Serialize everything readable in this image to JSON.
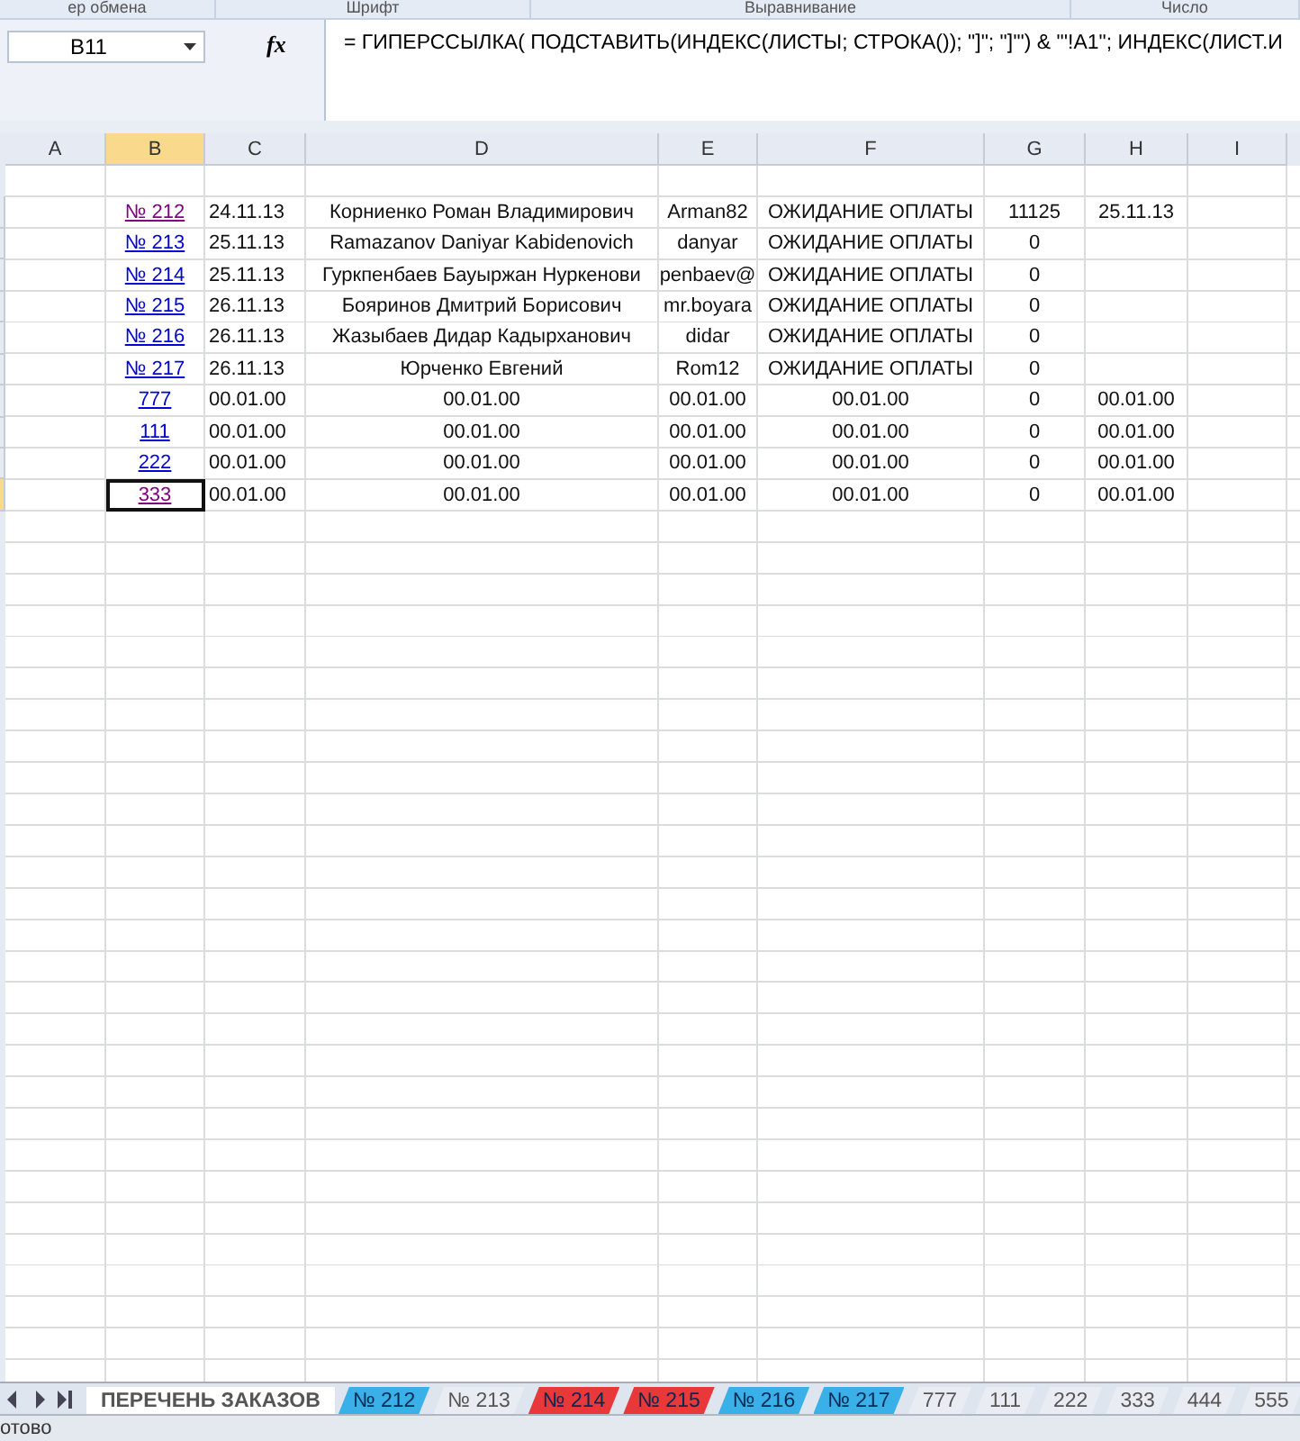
{
  "ribbon_groups": [
    "ер обмена",
    "Шрифт",
    "Выравнивание",
    "Число"
  ],
  "formula_bar": {
    "name_box": "B11",
    "fx": "fx",
    "formula": "= ГИПЕРССЫЛКА( ПОДСТАВИТЬ(ИНДЕКС(ЛИСТЫ; СТРОКА()); \"]\"; \"]'\") & \"'!A1\";  ИНДЕКС(ЛИСТ.И"
  },
  "columns": [
    {
      "label": "A",
      "selected": false
    },
    {
      "label": "B",
      "selected": true
    },
    {
      "label": "C",
      "selected": false
    },
    {
      "label": "D",
      "selected": false
    },
    {
      "label": "E",
      "selected": false
    },
    {
      "label": "F",
      "selected": false
    },
    {
      "label": "G",
      "selected": false
    },
    {
      "label": "H",
      "selected": false
    },
    {
      "label": "I",
      "selected": false
    }
  ],
  "rows": [
    {
      "link": "№ 212",
      "visited": true,
      "selected": false,
      "cells": [
        "24.11.13",
        "Корниенко Роман Владимирович",
        "Arman82",
        "ОЖИДАНИЕ ОПЛАТЫ",
        "11125",
        "25.11.13"
      ]
    },
    {
      "link": "№ 213",
      "visited": false,
      "selected": false,
      "cells": [
        "25.11.13",
        "Ramazanov Daniyar Kabidenovich",
        "danyar",
        "ОЖИДАНИЕ ОПЛАТЫ",
        "0",
        ""
      ]
    },
    {
      "link": "№ 214",
      "visited": false,
      "selected": false,
      "cells": [
        "25.11.13",
        "Гуркпенбаев Бауыржан Нуркенови",
        "penbaev@",
        "ОЖИДАНИЕ ОПЛАТЫ",
        "0",
        ""
      ]
    },
    {
      "link": "№ 215",
      "visited": false,
      "selected": false,
      "cells": [
        "26.11.13",
        "Бояринов Дмитрий Борисович",
        "mr.boyara",
        "ОЖИДАНИЕ ОПЛАТЫ",
        "0",
        ""
      ]
    },
    {
      "link": "№ 216",
      "visited": false,
      "selected": false,
      "cells": [
        "26.11.13",
        "Жазыбаев Дидар Кадырханович",
        "didar",
        "ОЖИДАНИЕ ОПЛАТЫ",
        "0",
        ""
      ]
    },
    {
      "link": "№ 217",
      "visited": false,
      "selected": false,
      "cells": [
        "26.11.13",
        "Юрченко Евгений",
        "Rom12",
        "ОЖИДАНИЕ ОПЛАТЫ",
        "0",
        ""
      ]
    },
    {
      "link": "777",
      "visited": false,
      "selected": false,
      "cells": [
        "00.01.00",
        "00.01.00",
        "00.01.00",
        "00.01.00",
        "0",
        "00.01.00"
      ]
    },
    {
      "link": "111",
      "visited": false,
      "selected": false,
      "cells": [
        "00.01.00",
        "00.01.00",
        "00.01.00",
        "00.01.00",
        "0",
        "00.01.00"
      ]
    },
    {
      "link": "222",
      "visited": false,
      "selected": false,
      "cells": [
        "00.01.00",
        "00.01.00",
        "00.01.00",
        "00.01.00",
        "0",
        "00.01.00"
      ]
    },
    {
      "link": "333",
      "visited": true,
      "selected": true,
      "cells": [
        "00.01.00",
        "00.01.00",
        "00.01.00",
        "00.01.00",
        "0",
        "00.01.00"
      ]
    }
  ],
  "sheet_tabs": [
    {
      "label": "ПЕРЕЧЕНЬ ЗАКАЗОВ",
      "selected": true
    },
    {
      "label": "№ 212",
      "selected": false,
      "color": "#3ab0e8"
    },
    {
      "label": "№ 213",
      "selected": false
    },
    {
      "label": "№ 214",
      "selected": false,
      "color": "#e8383a"
    },
    {
      "label": "№ 215",
      "selected": false,
      "color": "#e8383a"
    },
    {
      "label": "№ 216",
      "selected": false,
      "color": "#3ab0e8"
    },
    {
      "label": "№ 217",
      "selected": false,
      "color": "#3ab0e8"
    },
    {
      "label": "777",
      "selected": false
    },
    {
      "label": "111",
      "selected": false
    },
    {
      "label": "222",
      "selected": false
    },
    {
      "label": "333",
      "selected": false
    },
    {
      "label": "444",
      "selected": false
    },
    {
      "label": "555",
      "selected": false
    }
  ],
  "status_bar": "отово"
}
